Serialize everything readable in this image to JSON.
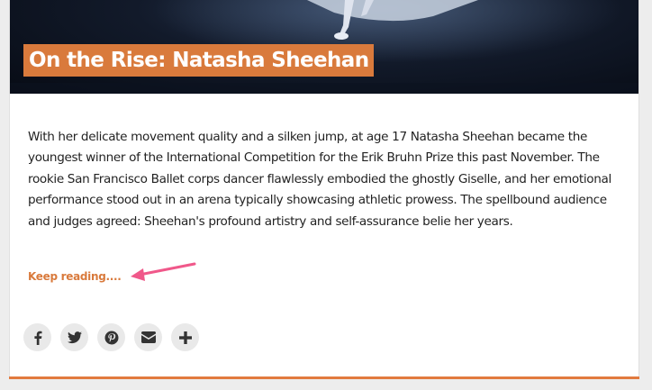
{
  "article": {
    "title": "On the Rise: Natasha Sheehan",
    "body": "With her delicate movement quality and a silken jump, at age 17 Natasha Sheehan became the youngest winner of the International Competition for the Erik Bruhn Prize this past November. The rookie San Francisco Ballet corps dancer flawlessly embodied the ghostly Giselle, and her emotional performance stood out in an arena typically showcasing athletic prowess. The spellbound audience and judges agreed: Sheehan's profound artistry and self-assurance belie her years.",
    "read_more_label": "Keep reading...."
  },
  "share_buttons": [
    {
      "icon": "facebook-icon"
    },
    {
      "icon": "twitter-icon"
    },
    {
      "icon": "pinterest-icon"
    },
    {
      "icon": "email-icon"
    },
    {
      "icon": "plus-icon"
    }
  ],
  "colors": {
    "accent": "#d97a3c",
    "annotation_arrow": "#f0588a",
    "icon": "#333333"
  }
}
